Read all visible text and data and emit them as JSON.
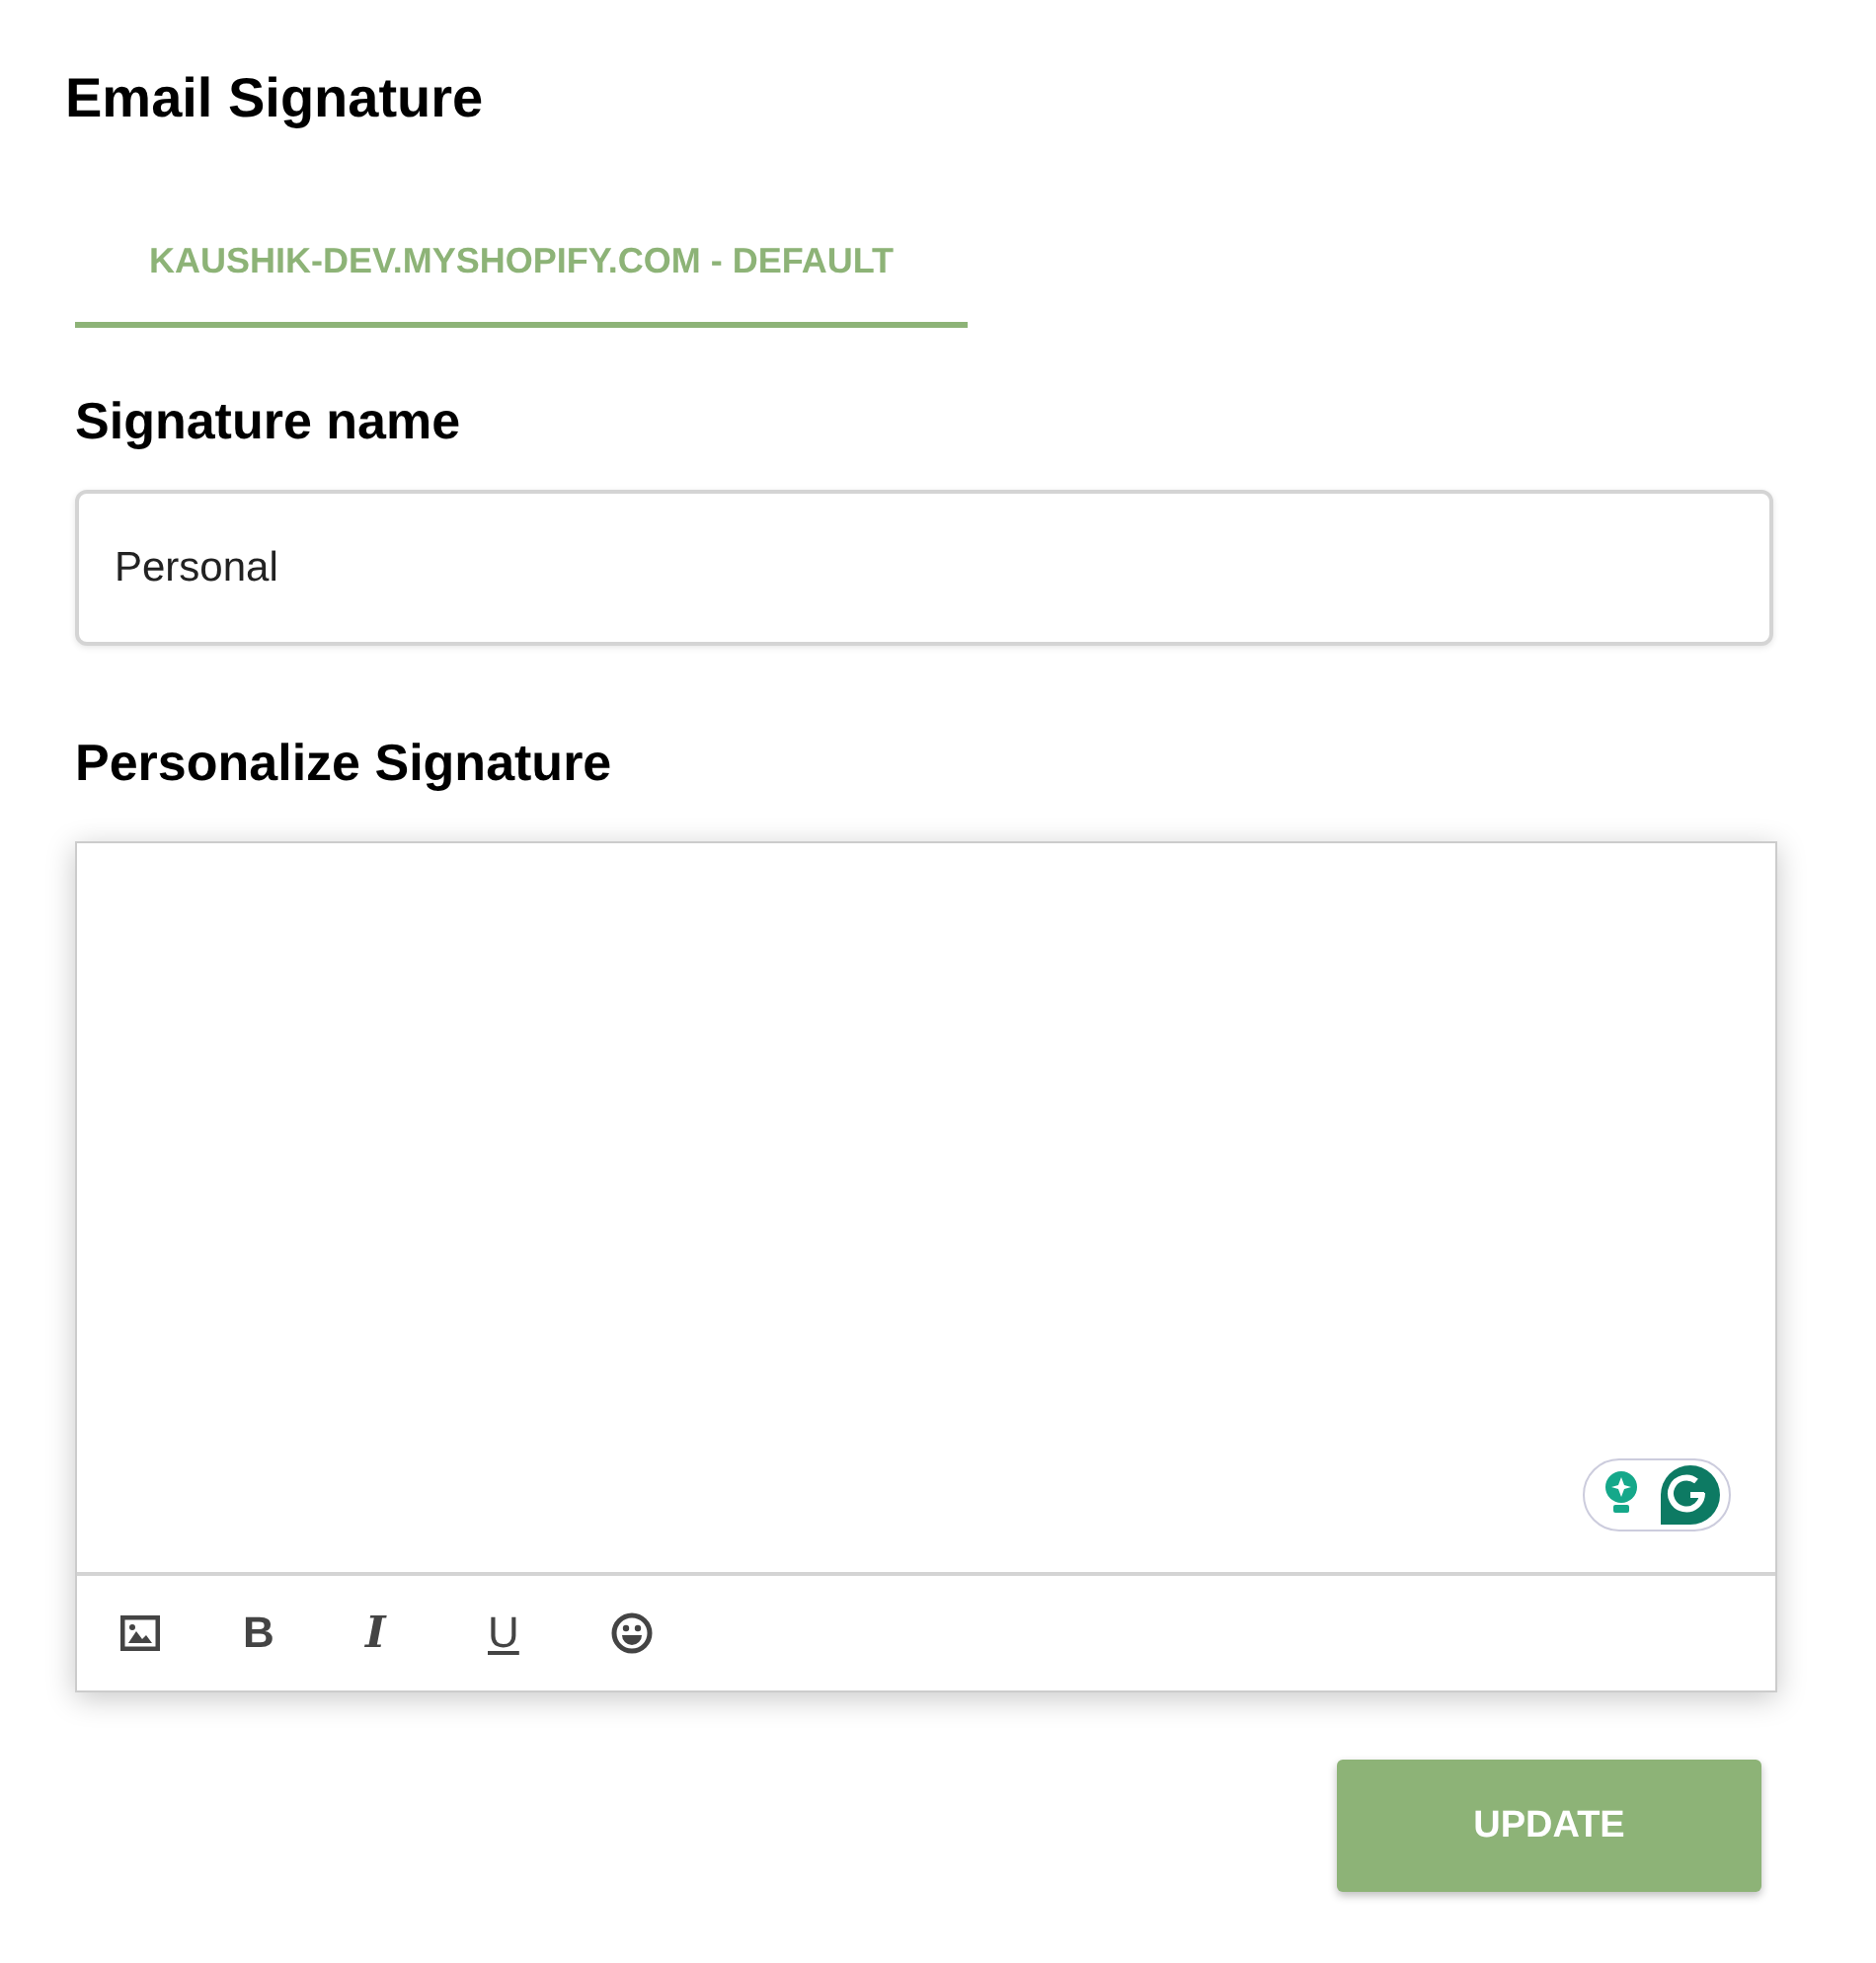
{
  "page_title": "Email Signature",
  "tabs": [
    {
      "label": "KAUSHIK-DEV.MYSHOPIFY.COM - DEFAULT",
      "selected": true
    }
  ],
  "signature_name": {
    "label": "Signature name",
    "value": "Personal"
  },
  "editor": {
    "label": "Personalize Signature",
    "toolbar": [
      {
        "kind": "image"
      },
      {
        "kind": "bold",
        "label": "B"
      },
      {
        "kind": "italic",
        "label": "I"
      },
      {
        "kind": "underline",
        "label": "U"
      },
      {
        "kind": "emoji"
      }
    ]
  },
  "buttons": [
    {
      "label": "UPDATE"
    }
  ]
}
